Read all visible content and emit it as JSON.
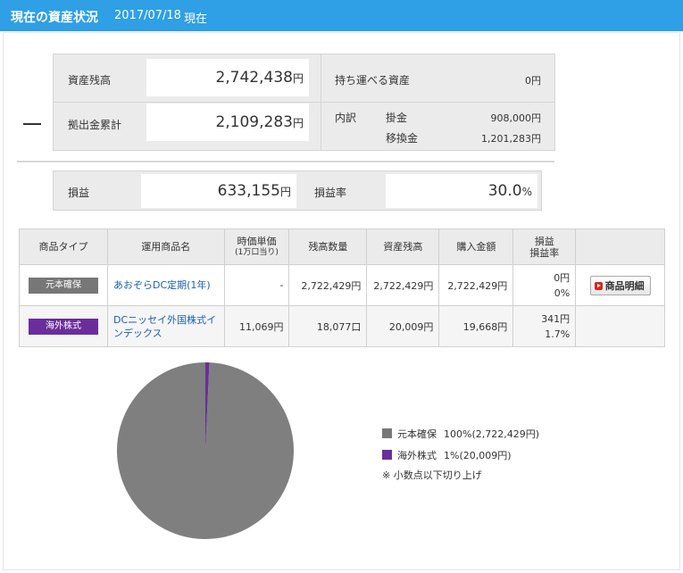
{
  "header": {
    "title": "現在の資産状況",
    "date": "2017/07/18",
    "suffix": "現在"
  },
  "summary": {
    "balance_label": "資産残高",
    "balance_value": "2,742,438",
    "balance_unit": "円",
    "contrib_label": "拠出金累計",
    "contrib_value": "2,109,283",
    "contrib_unit": "円",
    "portable_label": "持ち運べる資産",
    "portable_value": "0円",
    "breakdown_label": "内訳",
    "kakekin_label": "掛金",
    "kakekin_value": "908,000円",
    "ikan_label": "移換金",
    "ikan_value": "1,201,283円",
    "profit_label": "損益",
    "profit_value": "633,155",
    "profit_unit": "円",
    "rate_label": "損益率",
    "rate_value": "30.0",
    "rate_unit": "%"
  },
  "table": {
    "headers": {
      "type": "商品タイプ",
      "name": "運用商品名",
      "price": "時価単価",
      "price_sub": "(1万口当り)",
      "qty": "残高数量",
      "asset": "資産残高",
      "cost": "購入金額",
      "pl": "損益",
      "pl_rate": "損益率"
    },
    "rows": [
      {
        "type": "元本確保",
        "type_color": "#777777",
        "name": "あおぞらDC定期(1年)",
        "price": "-",
        "qty": "2,722,429円",
        "asset": "2,722,429円",
        "cost": "2,722,429円",
        "pl": "0円",
        "pl_rate": "0%",
        "detail": "商品明細"
      },
      {
        "type": "海外株式",
        "type_color": "#6a2e9c",
        "name": "DCニッセイ外国株式インデックス",
        "price": "11,069円",
        "qty": "18,077口",
        "asset": "20,009円",
        "cost": "19,668円",
        "pl": "341円",
        "pl_rate": "1.7%"
      }
    ]
  },
  "chart_data": {
    "type": "pie",
    "categories": [
      "元本確保",
      "海外株式"
    ],
    "values": [
      2722429,
      20009
    ],
    "colors": [
      "#7f7f7f",
      "#6a2e9c"
    ],
    "legend": [
      {
        "name": "元本確保",
        "text": "100%(2,722,429円)",
        "color": "#777777"
      },
      {
        "name": "海外株式",
        "text": "1%(20,009円)",
        "color": "#6a2e9c"
      }
    ],
    "note": "※ 小数点以下切り上げ"
  }
}
